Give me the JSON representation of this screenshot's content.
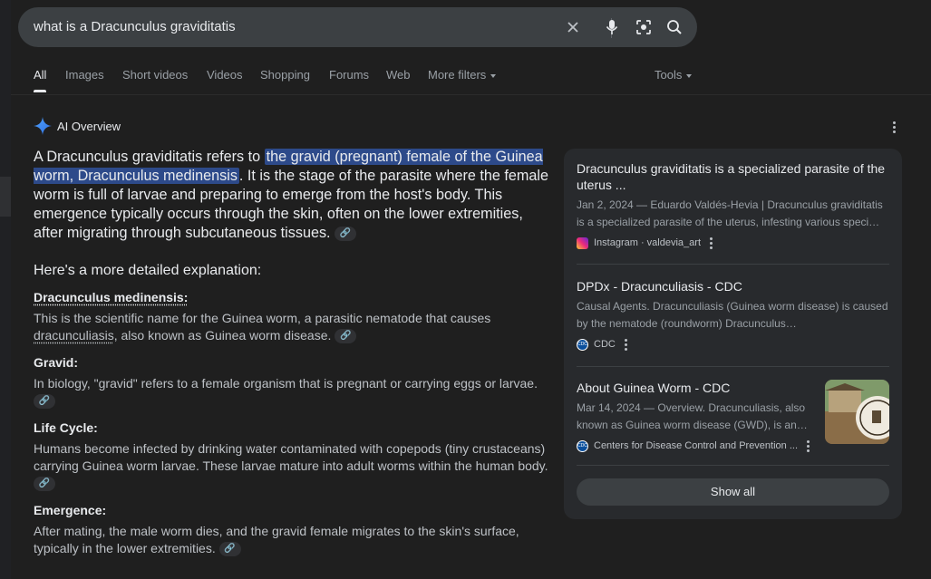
{
  "search": {
    "query": "what is a Dracunculus graviditatis"
  },
  "tabs": [
    {
      "label": "All"
    },
    {
      "label": "Images"
    },
    {
      "label": "Short videos"
    },
    {
      "label": "Videos"
    },
    {
      "label": "Shopping"
    },
    {
      "label": "Forums"
    },
    {
      "label": "Web"
    },
    {
      "label": "More filters"
    }
  ],
  "tools_label": "Tools",
  "ai_overview": {
    "title": "AI Overview",
    "lead_prefix": "A Dracunculus graviditatis refers to ",
    "lead_highlight": "the gravid (pregnant) female of the Guinea worm, Dracunculus medinensis",
    "lead_suffix": ". It is the stage of the parasite where the female worm is full of larvae and preparing to emerge from the host's body. This emergence typically occurs through the skin, often on the lower extremities, after migrating through subcutaneous tissues.",
    "heading": "Here's a more detailed explanation:",
    "items": [
      {
        "title": "Dracunculus medinensis:",
        "body_prefix": "This is the scientific name for the Guinea worm, a parasitic nematode that causes ",
        "body_link": "dracunculiasis",
        "body_suffix": ", also known as Guinea worm disease."
      },
      {
        "title": "Gravid:",
        "body": "In biology, \"gravid\" refers to a female organism that is pregnant or carrying eggs or larvae."
      },
      {
        "title": "Life Cycle:",
        "body": "Humans become infected by drinking water contaminated with copepods (tiny crustaceans) carrying Guinea worm larvae. These larvae mature into adult worms within the human body."
      },
      {
        "title": "Emergence:",
        "body": "After mating, the male worm dies, and the gravid female migrates to the skin's surface, typically in the lower extremities."
      }
    ]
  },
  "sources": [
    {
      "title": "Dracunculus graviditatis is a specialized parasite of the uterus ...",
      "snippet": "Jan 2, 2024 — Eduardo Valdés-Hevia | Dracunculus graviditatis is a specialized parasite of the uterus, infesting various speci…",
      "site": "Instagram · valdevia_art",
      "favicon": "instagram-icon"
    },
    {
      "title": "DPDx - Dracunculiasis - CDC",
      "snippet": "Causal Agents. Dracunculiasis (Guinea worm disease) is caused by the nematode (roundworm) Dracunculus…",
      "site": "CDC",
      "favicon": "cdc-icon"
    },
    {
      "title": "About Guinea Worm - CDC",
      "snippet": "Mar 14, 2024 — Overview. Dracunculiasis, also known as Guinea worm disease (GWD), is an…",
      "site": "Centers for Disease Control and Prevention ...",
      "favicon": "cdc-icon"
    }
  ],
  "show_all_label": "Show all",
  "favicon_text": "CDC",
  "colors": {
    "background": "#1f1f1f",
    "searchbar": "#3c4043",
    "highlight": "#2d4a8a",
    "panel": "#282a2d"
  }
}
